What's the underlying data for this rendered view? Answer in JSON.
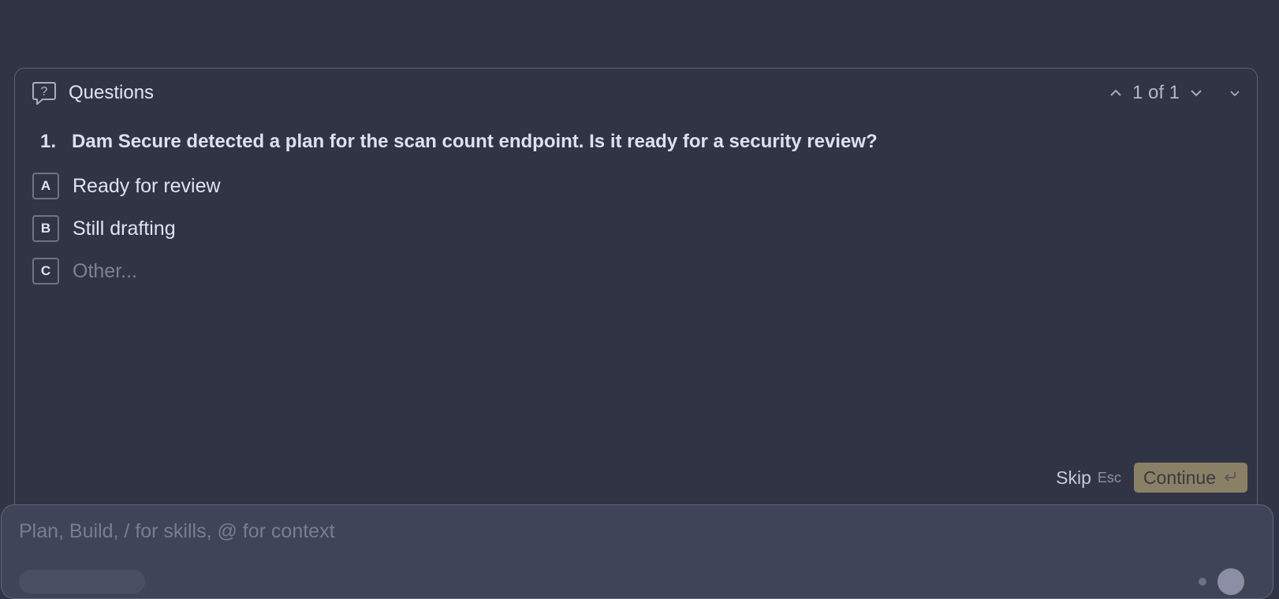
{
  "panel": {
    "title": "Questions",
    "icon": "question-bubble-icon",
    "pager": "1 of 1"
  },
  "question": {
    "number": "1.",
    "text": "Dam Secure detected a plan for the scan count endpoint. Is it ready for a security review?"
  },
  "options": [
    {
      "key": "A",
      "label": "Ready for review"
    },
    {
      "key": "B",
      "label": "Still drafting"
    },
    {
      "key": "C",
      "label": "Other..."
    }
  ],
  "footer": {
    "skip_label": "Skip",
    "skip_shortcut": "Esc",
    "continue_label": "Continue",
    "continue_icon": "enter-icon"
  },
  "composer": {
    "placeholder": "Plan, Build, / for skills, @ for context"
  },
  "colors": {
    "background": "#313445",
    "composer": "#404457",
    "continue_button": "#8a8066"
  }
}
